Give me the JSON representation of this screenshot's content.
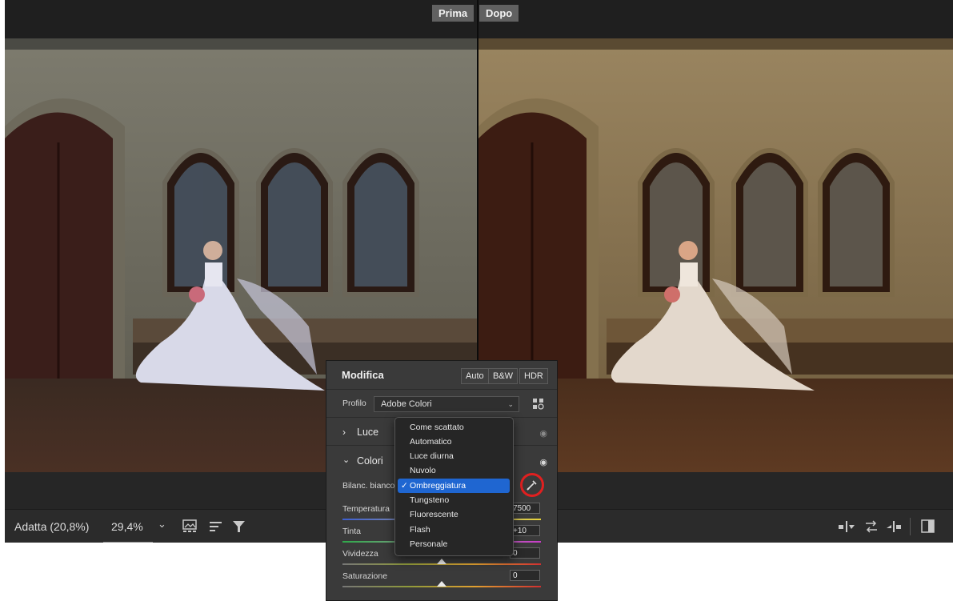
{
  "compare": {
    "before_label": "Prima",
    "after_label": "Dopo"
  },
  "bottombar": {
    "fit_label": "Adatta (20,8%)",
    "zoom_value": "29,4%",
    "zoom_chevron": "⌄"
  },
  "panel": {
    "title": "Modifica",
    "buttons": {
      "auto": "Auto",
      "bw": "B&W",
      "hdr": "HDR"
    },
    "profile_label": "Profilo",
    "profile_value": "Adobe Colori",
    "sections": {
      "light": "Luce",
      "colors": "Colori"
    },
    "white_balance_label": "Bilanc. bianco",
    "sliders": [
      {
        "label": "Temperatura",
        "value": "7500",
        "position": 0.7
      },
      {
        "label": "Tinta",
        "value": "+10",
        "position": 0.55
      },
      {
        "label": "Vividezza",
        "value": "0",
        "position": 0.5
      },
      {
        "label": "Saturazione",
        "value": "0",
        "position": 0.5
      }
    ]
  },
  "wb_menu": {
    "items": [
      "Come scattato",
      "Automatico",
      "Luce diurna",
      "Nuvolo",
      "Ombreggiatura",
      "Tungsteno",
      "Fluorescente",
      "Flash",
      "Personale"
    ],
    "selected_index": 4,
    "check_mark": "✓"
  },
  "colors": {
    "accent": "#1f66d1",
    "highlight_circle": "#e02020"
  }
}
